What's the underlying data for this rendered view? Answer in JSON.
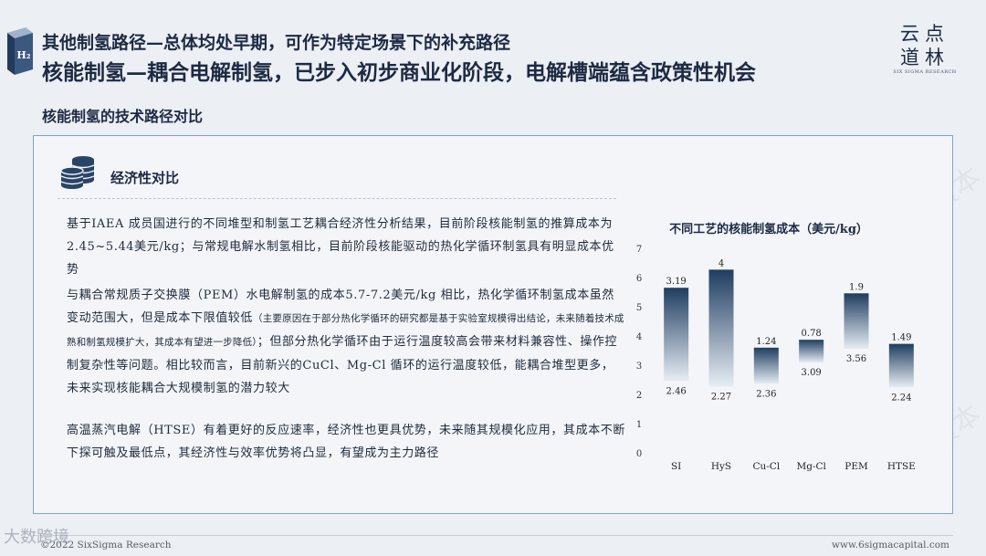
{
  "header": {
    "subtitle": "其他制氢路径—总体均处早期，可作为特定场景下的补充路径",
    "title": "核能制氢—耦合电解制氢，已步入初步商业化阶段，电解槽端蕴含政策性机会",
    "logo_glyph": "H₂",
    "brand_cn_line1": "云点",
    "brand_cn_line2": "道林",
    "brand_en": "SIX SIGMA RESEARCH"
  },
  "section_title": "核能制氢的技术路径对比",
  "card": {
    "heading": "经济性对比",
    "icon": "coin-stack-icon",
    "paragraphs": [
      {
        "text": "基于IAEA 成员国进行的不同堆型和制氢工艺耦合经济性分析结果，目前阶段核能制氢的推算成本为2.45~5.44美元/kg；与常规电解水制氢相比，目前阶段核能驱动的热化学循环制氢具有明显成本优势"
      },
      {
        "text_before": "与耦合常规质子交换膜（PEM）水电解制氢的成本5.7-7.2美元/kg 相比，热化学循环制氢成本虽然变动范围大，但是成本下限值较低",
        "small": "（主要原因在于部分热化学循环的研究都是基于实验室规模得出结论，未来随着技术成熟和制氢规模扩大，其成本有望进一步降低）",
        "text_after": "；但部分热化学循环由于运行温度较高会带来材料兼容性、操作控制复杂性等问题。相比较而言，目前新兴的CuCl、Mg-Cl 循环的运行温度较低，能耦合堆型更多，未来实现核能耦合大规模制氢的潜力较大"
      },
      {
        "text": "高温蒸汽电解（HTSE）有着更好的反应速率，经济性也更具优势，未来随其规模化应用，其成本不断下探可触及最低点，其经济性与效率优势将凸显，有望成为主力路径"
      }
    ]
  },
  "chart_data": {
    "type": "bar",
    "subtype": "floating-range",
    "title": "不同工艺的核能制氢成本（美元/kg）",
    "categories": [
      "SI",
      "HyS",
      "Cu-Cl",
      "Mg-Cl",
      "PEM",
      "HTSE"
    ],
    "series": [
      {
        "name": "min",
        "values": [
          2.46,
          2.27,
          2.36,
          3.09,
          3.56,
          2.24
        ]
      },
      {
        "name": "range",
        "values": [
          3.19,
          4,
          1.24,
          0.78,
          1.9,
          1.49
        ]
      }
    ],
    "yticks": [
      0,
      1,
      2,
      3,
      4,
      5,
      6,
      7
    ],
    "ylim": [
      0,
      7
    ],
    "colors": {
      "bar_top": "#1f3d60",
      "bar_bottom": "#e6edf4"
    }
  },
  "footer": {
    "copyright": "©2022 SixSigma Research",
    "website": "www.6sigmacapital.com",
    "watermark_logo": "大数跨境"
  },
  "watermark_text": "云道资本"
}
